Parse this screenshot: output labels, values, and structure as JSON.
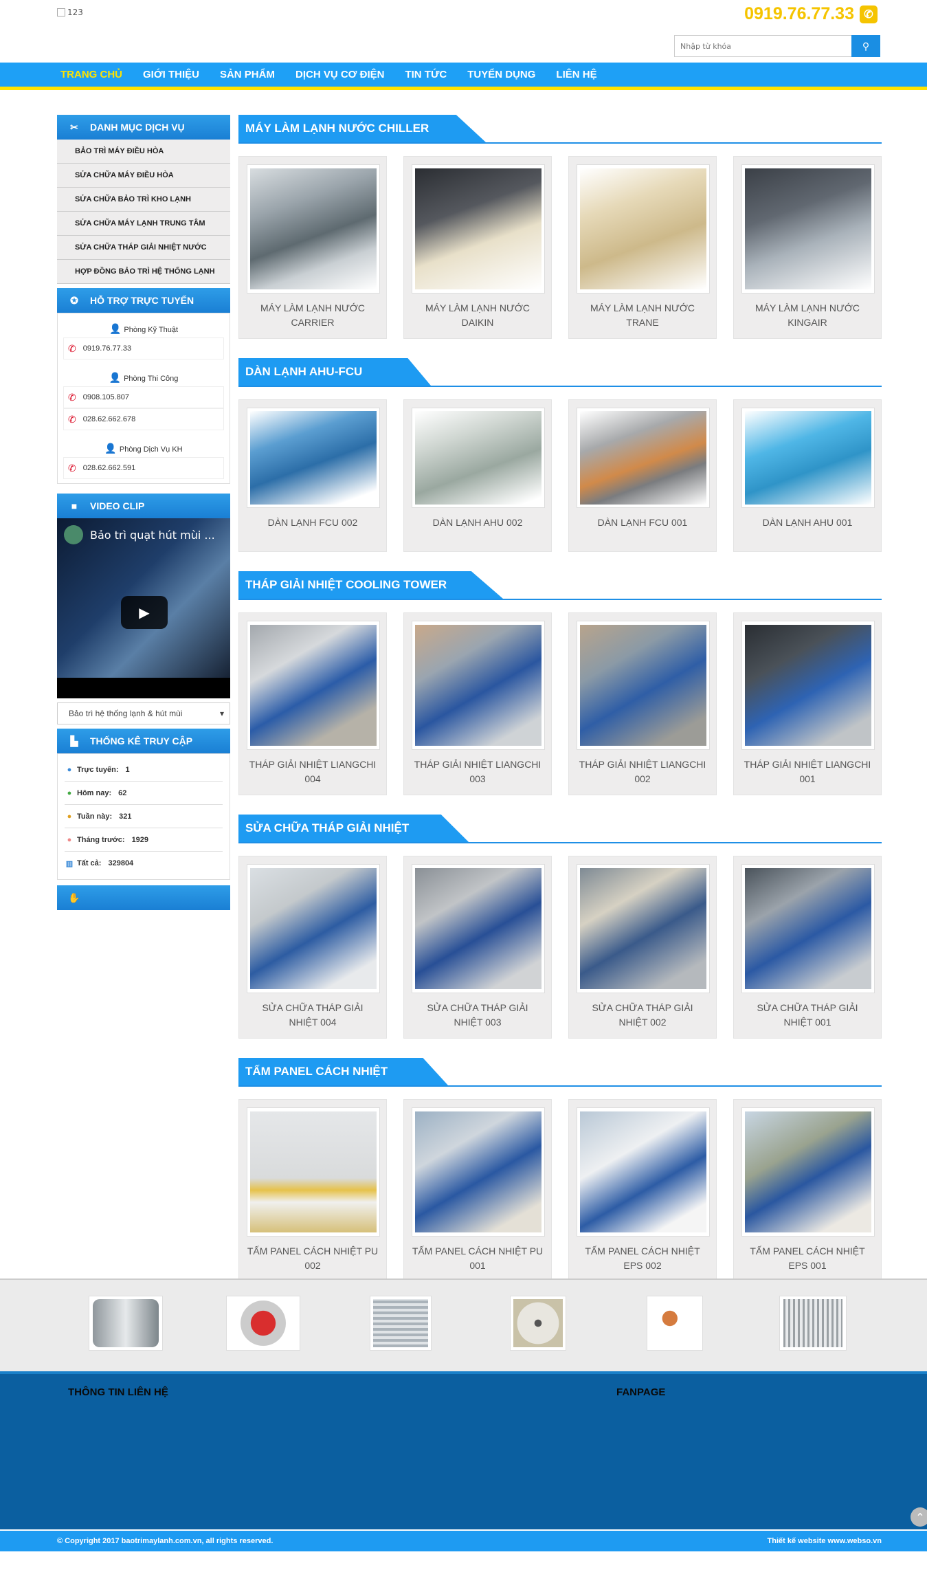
{
  "header": {
    "logo_alt": "123",
    "hotline": "0919.76.77.33",
    "search_placeholder": "Nhập từ khóa"
  },
  "nav": {
    "items": [
      "TRANG CHỦ",
      "GIỚI THIỆU",
      "SẢN PHẨM",
      "DỊCH VỤ CƠ ĐIỆN",
      "TIN TỨC",
      "TUYỂN DỤNG",
      "LIÊN HỆ"
    ],
    "active": "TRANG CHỦ"
  },
  "sidebar": {
    "menu_title": "DANH MỤC DỊCH VỤ",
    "menu": [
      "BẢO TRÌ MÁY ĐIỀU HÒA",
      "SỬA CHỮA MÁY ĐIỀU HÒA",
      "SỬA CHỮA BẢO TRÌ KHO LẠNH",
      "SỬA CHỮA MÁY LẠNH TRUNG TÂM",
      "SỬA CHỮA THÁP GIẢI NHIỆT NƯỚC",
      "HỢP ĐỒNG BẢO TRÌ HỆ THỐNG LẠNH"
    ],
    "support_title": "HỖ TRỢ TRỰC TUYẾN",
    "support": [
      {
        "dept": "Phòng Kỹ Thuật",
        "phones": [
          "0919.76.77.33"
        ]
      },
      {
        "dept": "Phòng Thi Công",
        "phones": [
          "0908.105.807",
          "028.62.662.678"
        ]
      },
      {
        "dept": "Phòng Dịch Vụ KH",
        "phones": [
          "028.62.662.591"
        ]
      }
    ],
    "video_title": "VIDEO CLIP",
    "video_caption": "Bảo trì quạt hút mùi ...",
    "video_select": "Bảo trì hệ thống lạnh & hút mùi",
    "stats_title": "THỐNG KÊ TRUY CẬP",
    "stats": [
      {
        "label": "Trực tuyến:",
        "value": "1"
      },
      {
        "label": "Hôm nay:",
        "value": "62"
      },
      {
        "label": "Tuần này:",
        "value": "321"
      },
      {
        "label": "Tháng trước:",
        "value": "1929"
      },
      {
        "label": "Tất cả:",
        "value": "329804"
      }
    ]
  },
  "sections": [
    {
      "title": "MÁY LÀM LẠNH NƯỚC CHILLER",
      "items": [
        "MÁY LÀM LẠNH NƯỚC CARRIER",
        "MÁY LÀM LẠNH NƯỚC DAIKIN",
        "MÁY LÀM LẠNH NƯỚC TRANE",
        "MÁY LÀM LẠNH NƯỚC KINGAIR"
      ]
    },
    {
      "title": "DÀN LẠNH AHU-FCU",
      "items": [
        "DÀN LẠNH FCU 002",
        "DÀN LẠNH AHU 002",
        "DÀN LẠNH FCU 001",
        "DÀN LẠNH AHU 001"
      ]
    },
    {
      "title": "THÁP GIẢI NHIỆT COOLING TOWER",
      "items": [
        "THÁP GIẢI NHIỆT LIANGCHI 004",
        "THÁP GIẢI NHIỆT LIANGCHI 003",
        "THÁP GIẢI NHIỆT LIANGCHI 002",
        "THÁP GIẢI NHIỆT LIANGCHI 001"
      ]
    },
    {
      "title": "SỬA CHỮA THÁP GIẢI NHIỆT",
      "items": [
        "SỬA CHỮA THÁP GIẢI NHIỆT 004",
        "SỬA CHỮA THÁP GIẢI NHIỆT 003",
        "SỬA CHỮA THÁP GIẢI NHIỆT 002",
        "SỬA CHỮA THÁP GIẢI NHIỆT 001"
      ]
    },
    {
      "title": "TẤM PANEL CÁCH NHIỆT",
      "items": [
        "TẤM PANEL CÁCH NHIỆT PU 002",
        "TẤM PANEL CÁCH NHIỆT PU 001",
        "TẤM PANEL CÁCH NHIỆT EPS 002",
        "TẤM PANEL CÁCH NHIỆT EPS 001"
      ]
    }
  ],
  "footer": {
    "contact_title": "THÔNG TIN LIÊN HỆ",
    "fanpage_title": "FANPAGE",
    "copyright": "© Copyright 2017 baotrimaylanh.com.vn, all rights reserved.",
    "designer": "Thiết kế website www.webso.vn"
  },
  "colors": {
    "brand": "#1e9bf2",
    "accent": "#ffe300",
    "hotline": "#f5c400",
    "footer": "#0b5fa0"
  }
}
